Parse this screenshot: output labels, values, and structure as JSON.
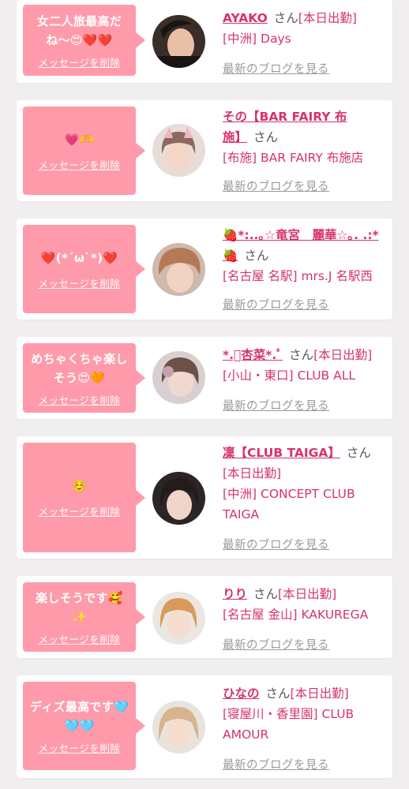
{
  "common": {
    "delete_label": "メッセージを削除",
    "san_label": "さん",
    "blog_label": "最新のブログを見る"
  },
  "colors": {
    "background": "#f1eeef",
    "bubble": "#ff9aaa",
    "accent": "#d6336c",
    "muted": "#9a9a9a"
  },
  "messages": [
    {
      "message_lines": [
        "女二人旅最高だ",
        "ね〜😍❤️❤️"
      ],
      "name": "AYAKO",
      "status": "[本日出勤]",
      "shop": "[中洲] Days"
    },
    {
      "message_lines": [
        "💗🫶"
      ],
      "name_lines": [
        "その【BAR FAIRY 布",
        "施】"
      ],
      "status": "",
      "shop": "[布施] BAR FAIRY 布施店"
    },
    {
      "message_lines": [
        "❤️(*´ω`*)❤️"
      ],
      "name_lines": [
        "🍓*:..｡☆竜宮　麗華☆｡. .:*",
        "🍓"
      ],
      "status": "",
      "shop": "[名古屋 名駅] mrs.J 名駅西"
    },
    {
      "message_lines": [
        "めちゃくちゃ楽し",
        "そう😍🧡"
      ],
      "name": "*.ﾟ杏菜*.ﾟ",
      "status": "[本日出勤]",
      "shop": "[小山・東口] CLUB ALL"
    },
    {
      "message_lines": [
        "☺️"
      ],
      "name": "凜【CLUB TAIGA】",
      "status": "[本日出勤]",
      "shop_lines": [
        "[中洲] CONCEPT CLUB",
        "TAIGA"
      ]
    },
    {
      "message_lines": [
        "楽しそうです🥰",
        "✨"
      ],
      "name": "りり",
      "status": "[本日出勤]",
      "shop": "[名古屋 金山] KAKUREGA"
    },
    {
      "message_lines": [
        "ディズ最高です🩵",
        "🩵🩵"
      ],
      "name": "ひなの",
      "status": "[本日出勤]",
      "shop_lines": [
        "[寝屋川・香里園] CLUB",
        "AMOUR"
      ]
    }
  ]
}
